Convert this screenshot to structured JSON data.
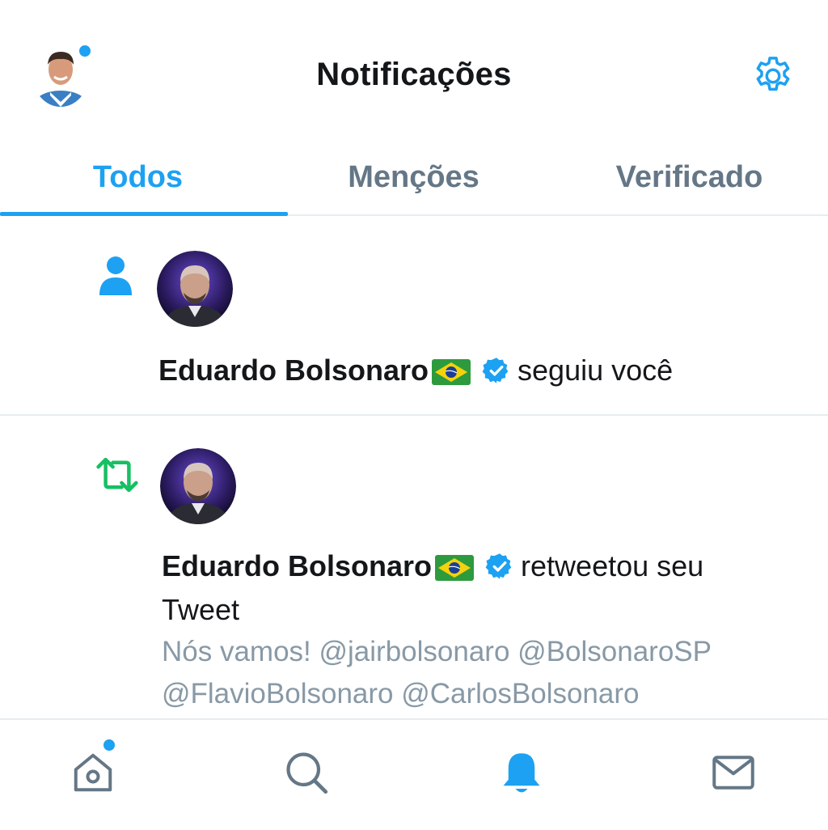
{
  "header": {
    "title": "Notificações",
    "avatar_icon": "profile-avatar",
    "settings_icon": "gear-icon",
    "has_unread_dot": true
  },
  "tabs": [
    {
      "label": "Todos",
      "active": true
    },
    {
      "label": "Menções",
      "active": false
    },
    {
      "label": "Verificado",
      "active": false
    }
  ],
  "notifications": [
    {
      "type": "follow",
      "type_icon": "person-icon",
      "actor_name": "Eduardo Bolsonaro",
      "flag_icon": "brazil-flag-icon",
      "verified": true,
      "action": "seguiu você"
    },
    {
      "type": "retweet",
      "type_icon": "retweet-icon",
      "actor_name": "Eduardo Bolsonaro",
      "flag_icon": "brazil-flag-icon",
      "verified": true,
      "action_line1": "retweetou seu",
      "action_line2": "Tweet",
      "tweet_text_line1": "Nós vamos! @jairbolsonaro @BolsonaroSP",
      "tweet_text_line2": "@FlavioBolsonaro @CarlosBolsonaro"
    }
  ],
  "bottom_nav": [
    {
      "icon": "home-icon",
      "active": false,
      "has_dot": true
    },
    {
      "icon": "search-icon",
      "active": false
    },
    {
      "icon": "bell-icon",
      "active": true
    },
    {
      "icon": "mail-icon",
      "active": false
    }
  ],
  "colors": {
    "accent": "#1da1f2",
    "retweet_green": "#17bf63",
    "text_primary": "#14171a",
    "text_secondary": "#657786",
    "tweet_text": "#8899a6",
    "divider": "#e6ecf0"
  }
}
